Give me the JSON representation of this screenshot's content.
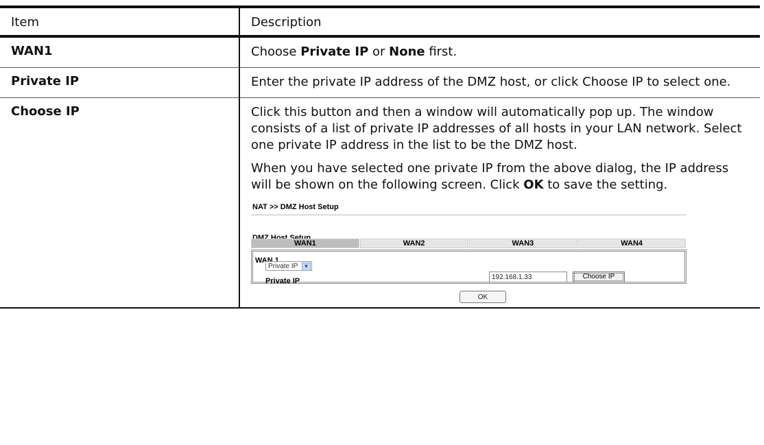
{
  "header": {
    "item": "Item",
    "description": "Description"
  },
  "rows": [
    {
      "item": "WAN1",
      "desc": {
        "a": "Choose ",
        "b1": "Private IP",
        "c": " or ",
        "b2": "None",
        "d": " first."
      }
    },
    {
      "item": "Private IP",
      "desc": {
        "text": "Enter the private IP address of the DMZ host, or click Choose IP to select one."
      }
    },
    {
      "item": "Choose IP",
      "desc": {
        "p1": "Click this button and then a window will automatically pop up. The window consists of a list of private IP addresses of all hosts in your LAN network. Select one private IP address in the list to be the DMZ host.",
        "p2a": "When you have selected one private IP from the above dialog, the IP address will be shown on the following screen. Click ",
        "p2b": "OK",
        "p2c": " to save the setting."
      }
    }
  ],
  "screen": {
    "breadcrumb": "NAT >> DMZ Host Setup",
    "section": "DMZ Host Setup",
    "tabs": [
      "WAN1",
      "WAN2",
      "WAN3",
      "WAN4"
    ],
    "active_tab": "WAN1",
    "wan_label": "WAN 1",
    "select_value": "Private IP",
    "private_ip_label": "Private IP",
    "private_ip_value": "192.168.1.33",
    "choose_ip_button": "Choose IP",
    "ok_button": "OK"
  }
}
